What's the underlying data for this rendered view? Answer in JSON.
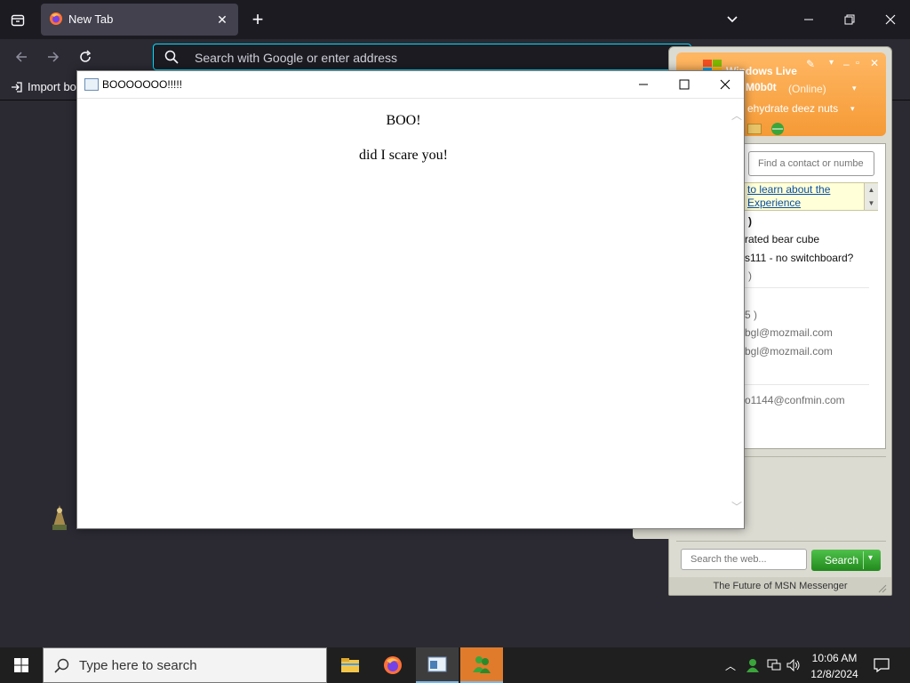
{
  "firefox": {
    "tab_title": "New Tab",
    "url_placeholder": "Search with Google or enter address",
    "import_bookmarks": "Import bo"
  },
  "msn": {
    "title": "Windows Live",
    "display_name": "M0b0t",
    "status": "(Online)",
    "personal_message": "ehydrate deez nuts",
    "find_placeholder": "Find a contact or numbe",
    "ad_line1": "to learn about the",
    "ad_line2": "Experience",
    "contacts": [
      ")",
      "rated bear cube",
      "s111 - no switchboard?",
      ")",
      "5 )",
      "bgl@mozmail.com",
      "bgl@mozmail.com",
      "o1144@confmin.com"
    ],
    "web_search_placeholder": "Search the web...",
    "search_button": "Search",
    "footer": "The Future of MSN Messenger"
  },
  "popup": {
    "title": "BOOOOOOO!!!!!",
    "heading": "BOO!",
    "text": "did I scare you!"
  },
  "taskbar": {
    "search_placeholder": "Type here to search",
    "time": "10:06 AM",
    "date": "12/8/2024"
  },
  "colors": {
    "firefox_dark": "#1c1b22",
    "urlbar_focus": "#00ddff",
    "msn_orange": "#f59a36",
    "msn_green": "#2aa327",
    "taskbar": "#1f1f1f"
  }
}
